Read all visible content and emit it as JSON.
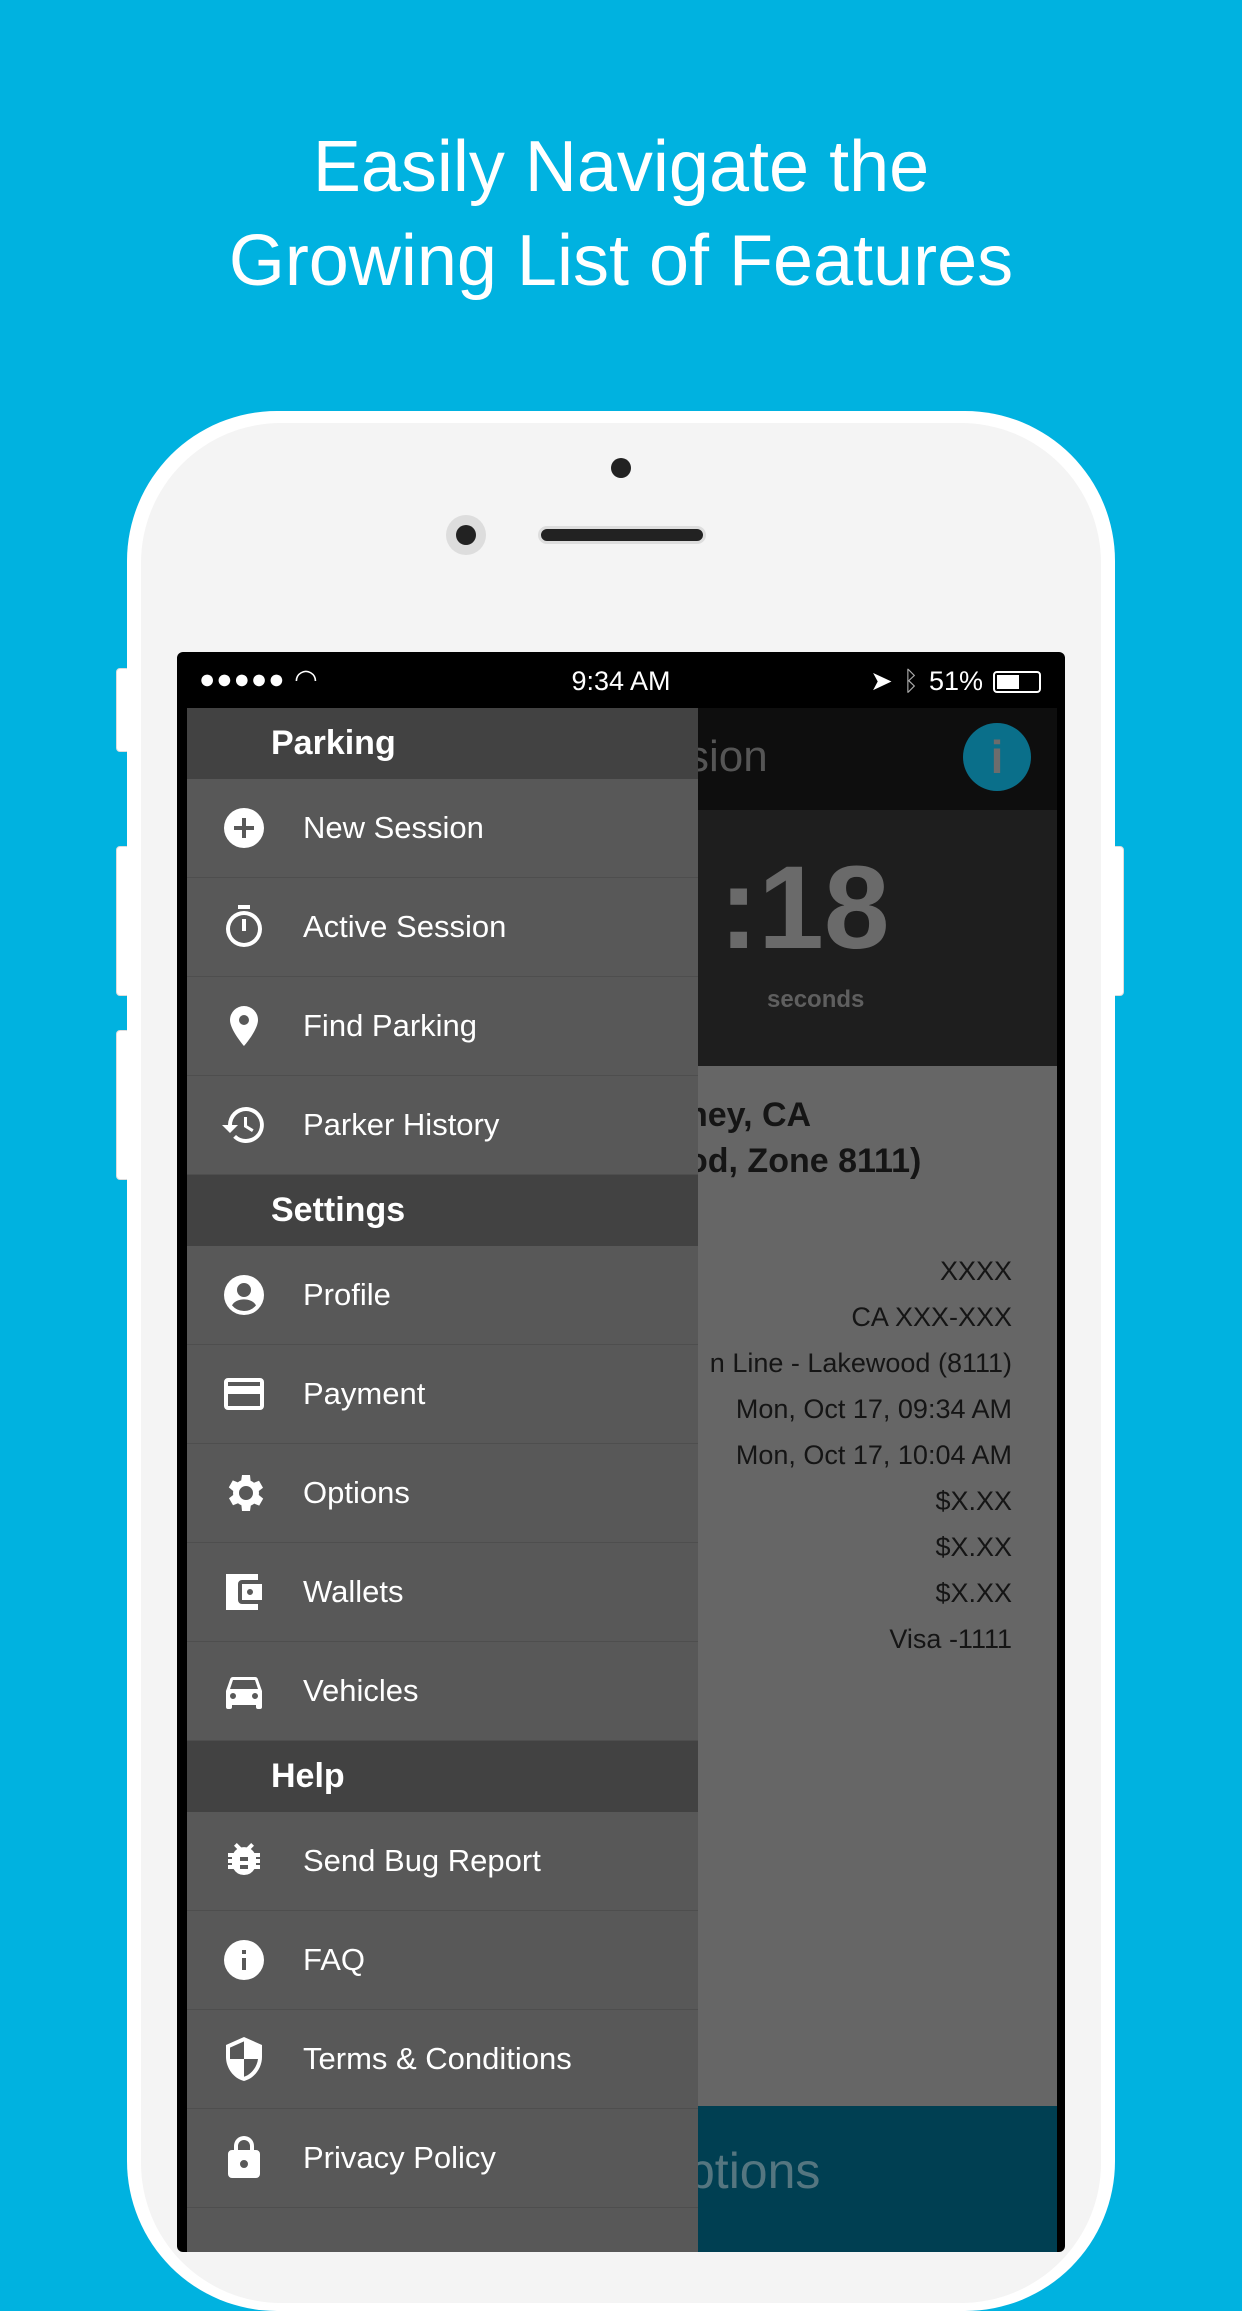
{
  "headline": {
    "line1": "Easily Navigate the",
    "line2": "Growing List of Features"
  },
  "status_bar": {
    "signal": "●●●●●",
    "time": "9:34 AM",
    "battery": "51%"
  },
  "background_app": {
    "header_title_partial": "sion",
    "timer_value_partial": ":18",
    "timer_unit": "seconds",
    "location_line1_partial": "ney, CA",
    "location_line2_partial": "od, Zone 8111)",
    "values": [
      "XXXX",
      "CA XXX-XXX",
      "n Line - Lakewood (8111)",
      "Mon, Oct 17, 09:34 AM",
      "Mon, Oct 17, 10:04 AM",
      "$X.XX",
      "$X.XX",
      "$X.XX",
      "Visa -1111"
    ],
    "bottom_button_partial": "ptions",
    "accent": "#0a6f8a"
  },
  "drawer": {
    "sections": [
      {
        "title": "Parking",
        "items": [
          {
            "label": "New Session",
            "icon": "plus-circle-icon"
          },
          {
            "label": "Active Session",
            "icon": "stopwatch-icon"
          },
          {
            "label": "Find Parking",
            "icon": "map-pin-icon"
          },
          {
            "label": "Parker History",
            "icon": "history-icon"
          }
        ]
      },
      {
        "title": "Settings",
        "items": [
          {
            "label": "Profile",
            "icon": "user-icon"
          },
          {
            "label": "Payment",
            "icon": "credit-card-icon"
          },
          {
            "label": "Options",
            "icon": "gear-icon"
          },
          {
            "label": "Wallets",
            "icon": "wallet-icon"
          },
          {
            "label": "Vehicles",
            "icon": "car-icon"
          }
        ]
      },
      {
        "title": "Help",
        "items": [
          {
            "label": "Send Bug Report",
            "icon": "bug-icon"
          },
          {
            "label": "FAQ",
            "icon": "info-icon"
          },
          {
            "label": "Terms & Conditions",
            "icon": "shield-icon"
          },
          {
            "label": "Privacy Policy",
            "icon": "lock-icon"
          }
        ]
      }
    ]
  }
}
